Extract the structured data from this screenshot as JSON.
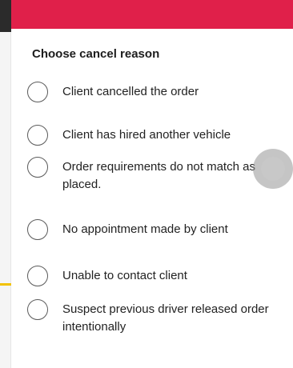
{
  "header": {
    "accent_color": "#e0204a"
  },
  "sheet": {
    "title": "Choose cancel reason"
  },
  "reasons": [
    {
      "label": "Client cancelled the order",
      "selected": false
    },
    {
      "label": "Client has hired another vehicle",
      "selected": false
    },
    {
      "label": "Order requirements do not match as placed.",
      "selected": false
    },
    {
      "label": "No appointment made by client",
      "selected": false
    },
    {
      "label": "Unable to contact client",
      "selected": false
    },
    {
      "label": "Suspect previous driver released order intentionally",
      "selected": false
    }
  ]
}
